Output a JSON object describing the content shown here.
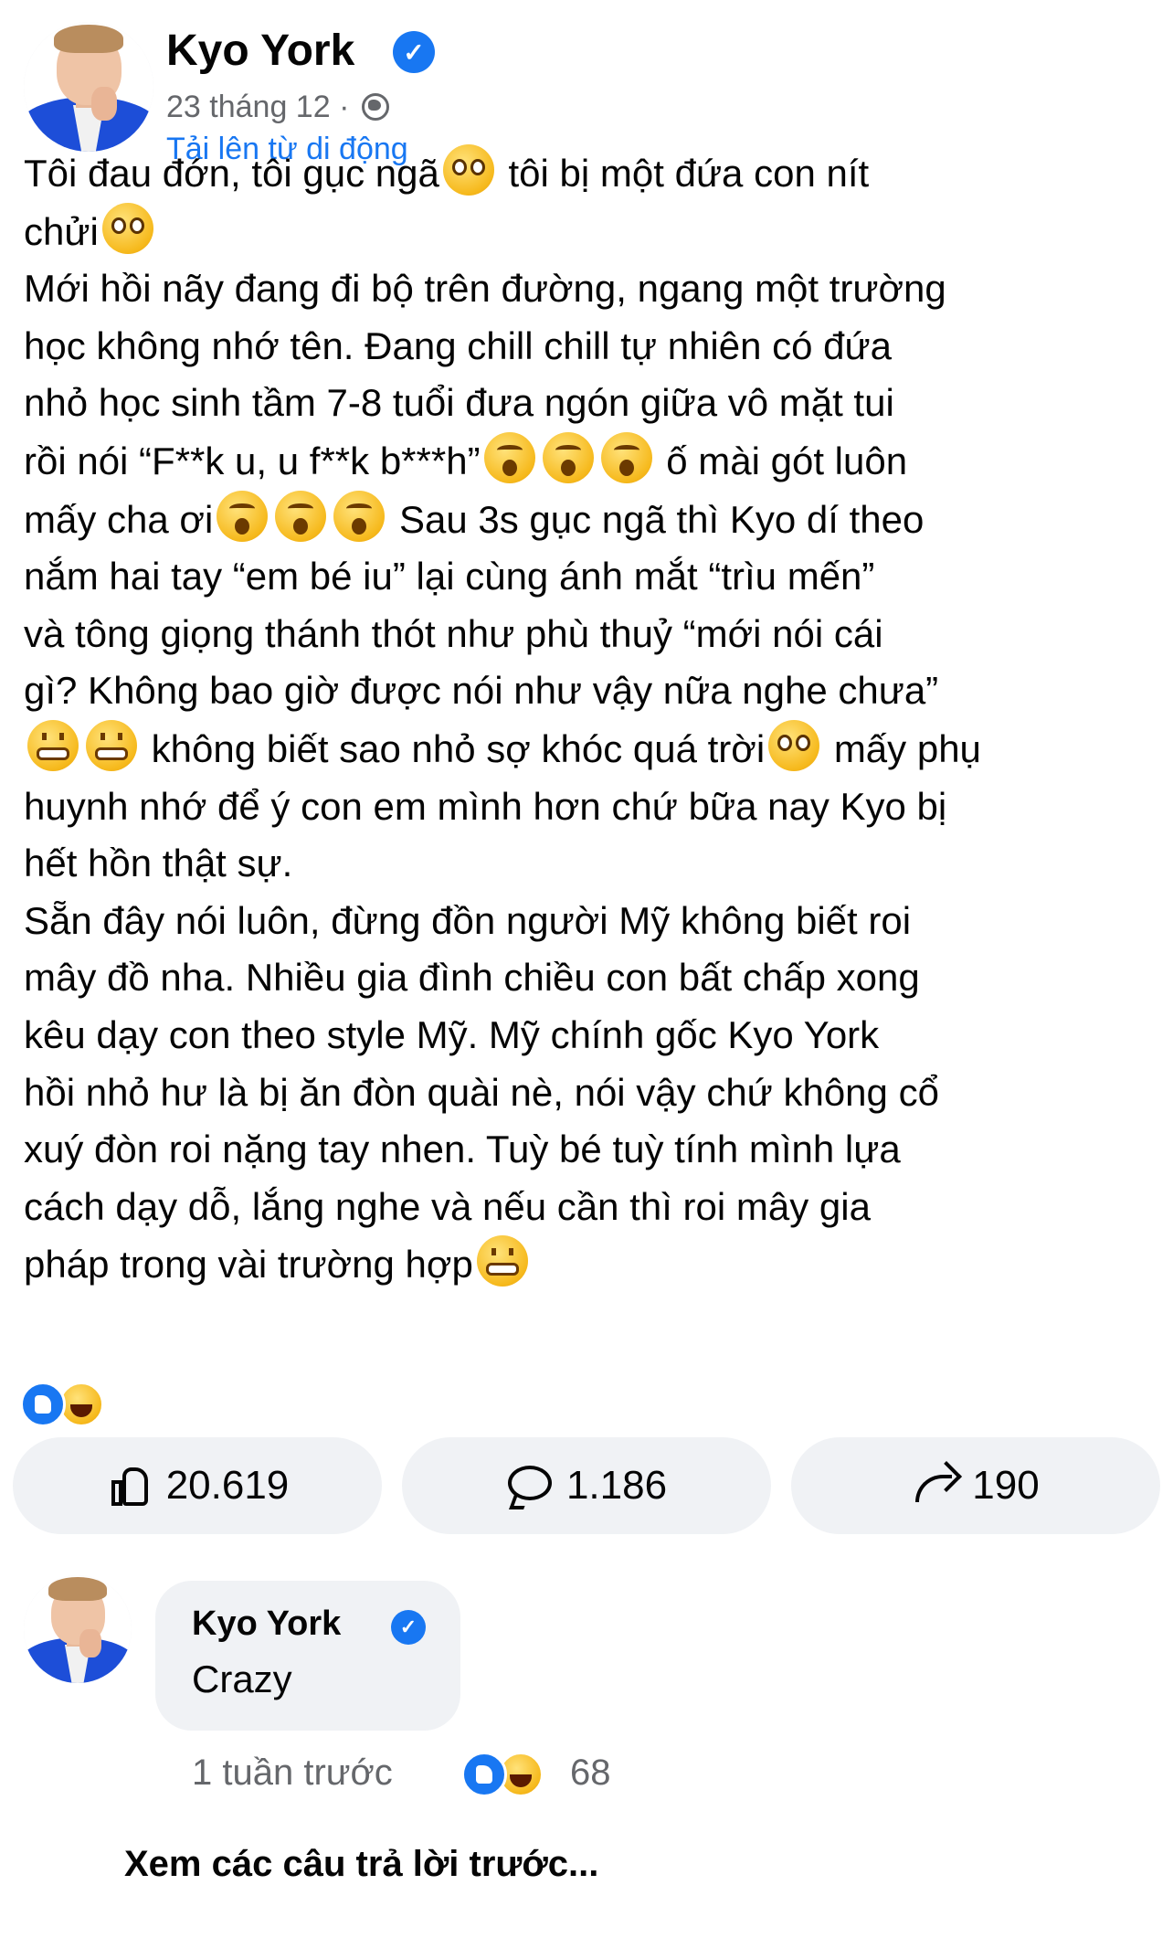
{
  "post": {
    "author": "Kyo York",
    "timestamp": "23 tháng 12",
    "separator": "·",
    "audience_icon": "globe-icon",
    "source": "Tải lên từ di động",
    "lines": [
      {
        "t": "Tôi đau đớn, tôi gục ngã",
        "e": "pleading",
        "t2": " tôi bị một đứa con nít"
      },
      {
        "t": "chửi",
        "e": "pleading"
      },
      {
        "t": "Mới hồi nãy đang đi bộ trên đường, ngang một trường"
      },
      {
        "t": "học không nhớ tên. Đang chill chill tự nhiên có đứa"
      },
      {
        "t": "nhỏ học sinh tầm 7-8 tuổi đưa ngón giữa vô mặt tui"
      },
      {
        "t": "rồi nói “F**k u, u f**k b***h”",
        "e3": "hushed",
        "t2": " ố mài gót luôn"
      },
      {
        "t": "mấy cha ơi",
        "e3": "hushed",
        "t2": " Sau 3s gục ngã thì Kyo dí theo"
      },
      {
        "t": "nắm hai tay “em bé iu” lại cùng ánh mắt “trìu mến”"
      },
      {
        "t": "và tông giọng thánh thót như phù thuỷ “mới nói cái"
      },
      {
        "t": "gì? Không bao giờ được nói như vậy nữa nghe chưa”"
      },
      {
        "t": "",
        "e2": "grimace",
        "t2": " không biết sao nhỏ sợ khóc quá trời",
        "e_end": "pleading",
        "t3": " mấy phụ"
      },
      {
        "t": "huynh nhớ để ý con em mình hơn chứ bữa nay Kyo bị"
      },
      {
        "t": "hết hồn thật sự."
      },
      {
        "t": "Sẵn đây nói luôn, đừng đồn người Mỹ không biết roi"
      },
      {
        "t": "mây đồ nha. Nhiều gia đình chiều con bất chấp xong"
      },
      {
        "t": "kêu dạy con theo style Mỹ. Mỹ chính gốc Kyo York"
      },
      {
        "t": "hồi nhỏ hư là bị ăn đòn quài nè, nói vậy chứ không cổ"
      },
      {
        "t": "xuý đòn roi nặng tay nhen. Tuỳ bé tuỳ tính mình lựa"
      },
      {
        "t": "cách dạy dỗ, lắng nghe và nếu cần thì roi mây gia"
      },
      {
        "t": "pháp trong vài trường hợp",
        "e": "grimace"
      }
    ],
    "reaction_icons": [
      "like-icon",
      "haha-icon"
    ]
  },
  "actions": {
    "like_count": "20.619",
    "comment_count": "1.186",
    "share_count": "190"
  },
  "comment": {
    "author": "Kyo York",
    "text": "Crazy",
    "time": "1 tuần trước",
    "reaction_count": "68"
  },
  "footer": {
    "view_previous": "Xem các câu trả lời trước..."
  },
  "colors": {
    "accent": "#1877f2",
    "secondary_text": "#65676b",
    "button_bg": "#f0f2f5"
  }
}
